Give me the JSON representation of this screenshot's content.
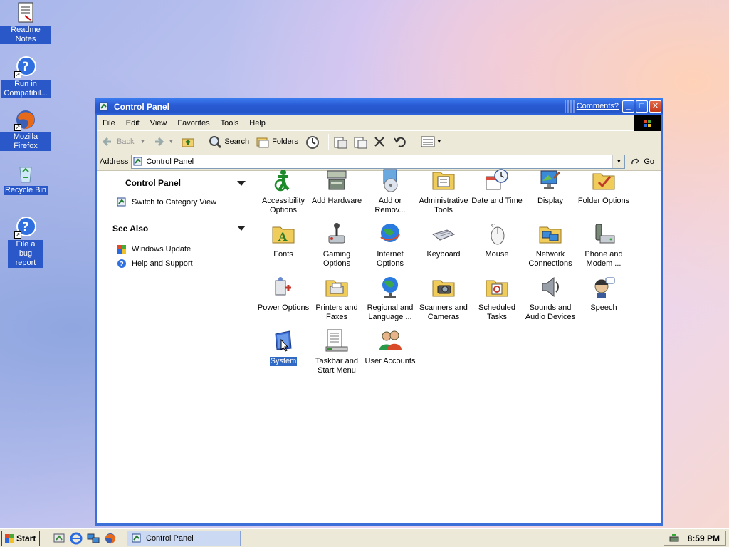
{
  "desktop": {
    "icons": [
      {
        "label": "Readme Notes",
        "icon": "notes-icon"
      },
      {
        "label": "Run in Compatibil...",
        "icon": "help-shortcut-icon"
      },
      {
        "label": "Mozilla Firefox",
        "icon": "firefox-icon"
      },
      {
        "label": "Recycle Bin",
        "icon": "recycle-bin-icon"
      },
      {
        "label": "File a bug report",
        "icon": "help-shortcut-icon"
      }
    ]
  },
  "window": {
    "title": "Control Panel",
    "comments_link": "Comments?",
    "minimize": "_",
    "maximize": "□",
    "close": "✕"
  },
  "menubar": [
    "File",
    "Edit",
    "View",
    "Favorites",
    "Tools",
    "Help"
  ],
  "toolbar": {
    "back": "Back",
    "search": "Search",
    "folders": "Folders"
  },
  "addressbar": {
    "label": "Address",
    "value": "Control Panel",
    "go": "Go"
  },
  "leftpane": {
    "panel_title": "Control Panel",
    "switch_view": "Switch to Category View",
    "see_also_title": "See Also",
    "see_also": [
      "Windows Update",
      "Help and Support"
    ]
  },
  "items": [
    {
      "label": "Accessibility Options",
      "icon": "accessibility-icon"
    },
    {
      "label": "Add Hardware",
      "icon": "add-hardware-icon"
    },
    {
      "label": "Add or Remov...",
      "icon": "add-remove-programs-icon"
    },
    {
      "label": "Administrative Tools",
      "icon": "admin-tools-icon"
    },
    {
      "label": "Date and Time",
      "icon": "date-time-icon"
    },
    {
      "label": "Display",
      "icon": "display-icon"
    },
    {
      "label": "Folder Options",
      "icon": "folder-options-icon"
    },
    {
      "label": "Fonts",
      "icon": "fonts-icon"
    },
    {
      "label": "Gaming Options",
      "icon": "gaming-icon"
    },
    {
      "label": "Internet Options",
      "icon": "internet-options-icon"
    },
    {
      "label": "Keyboard",
      "icon": "keyboard-icon"
    },
    {
      "label": "Mouse",
      "icon": "mouse-icon"
    },
    {
      "label": "Network Connections",
      "icon": "network-icon"
    },
    {
      "label": "Phone and Modem ...",
      "icon": "phone-modem-icon"
    },
    {
      "label": "Power Options",
      "icon": "power-options-icon"
    },
    {
      "label": "Printers and Faxes",
      "icon": "printers-icon"
    },
    {
      "label": "Regional and Language ...",
      "icon": "regional-icon"
    },
    {
      "label": "Scanners and Cameras",
      "icon": "scanners-icon"
    },
    {
      "label": "Scheduled Tasks",
      "icon": "scheduled-tasks-icon"
    },
    {
      "label": "Sounds and Audio Devices",
      "icon": "sounds-icon"
    },
    {
      "label": "Speech",
      "icon": "speech-icon"
    },
    {
      "label": "System",
      "icon": "system-icon"
    },
    {
      "label": "Taskbar and Start Menu",
      "icon": "taskbar-icon"
    },
    {
      "label": "User Accounts",
      "icon": "user-accounts-icon"
    }
  ],
  "taskbar": {
    "start": "Start",
    "task": "Control Panel",
    "clock": "8:59 PM"
  }
}
